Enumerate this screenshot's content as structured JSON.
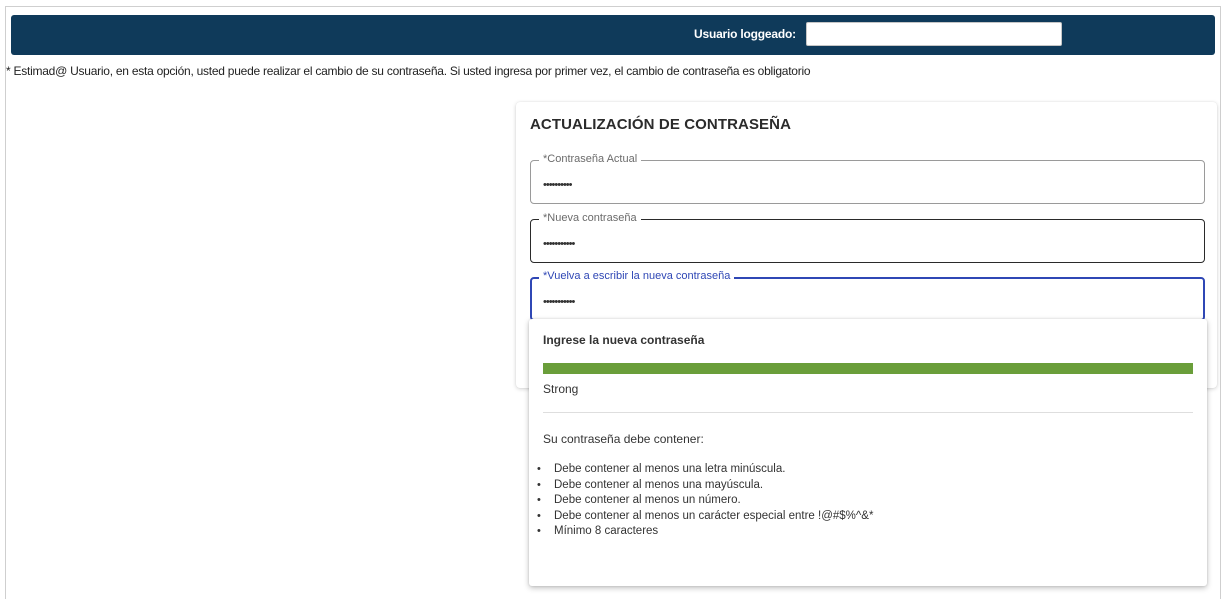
{
  "header": {
    "user_label": "Usuario loggeado:",
    "user_value": "",
    "bar_color": "#0f3a5a"
  },
  "notice": "* Estimad@ Usuario, en esta opción, usted puede realizar el cambio de su contraseña. Si usted ingresa por primer vez, el cambio de contraseña es obligatorio",
  "form": {
    "title": "ACTUALIZACIÓN DE CONTRASEÑA",
    "fields": [
      {
        "label": "*Contraseña Actual",
        "value": "••••••••••"
      },
      {
        "label": "*Nueva contraseña",
        "value": "•••••••••••"
      },
      {
        "label": "*Vuelva a escribir la nueva contraseña",
        "value": "•••••••••••"
      }
    ],
    "focus_color": "#2f47b5"
  },
  "password_popover": {
    "title": "Ingrese la nueva contraseña",
    "strength_label": "Strong",
    "strength_fraction": 1.0,
    "strength_color": "#6a9e3a",
    "requirements_title": "Su contraseña debe contener:",
    "requirements": [
      "Debe contener al menos una letra minúscula.",
      "Debe contener al menos una mayúscula.",
      "Debe contener al menos un número.",
      "Debe contener al menos un carácter especial entre !@#$%^&*",
      "Mínimo 8 caracteres"
    ]
  }
}
